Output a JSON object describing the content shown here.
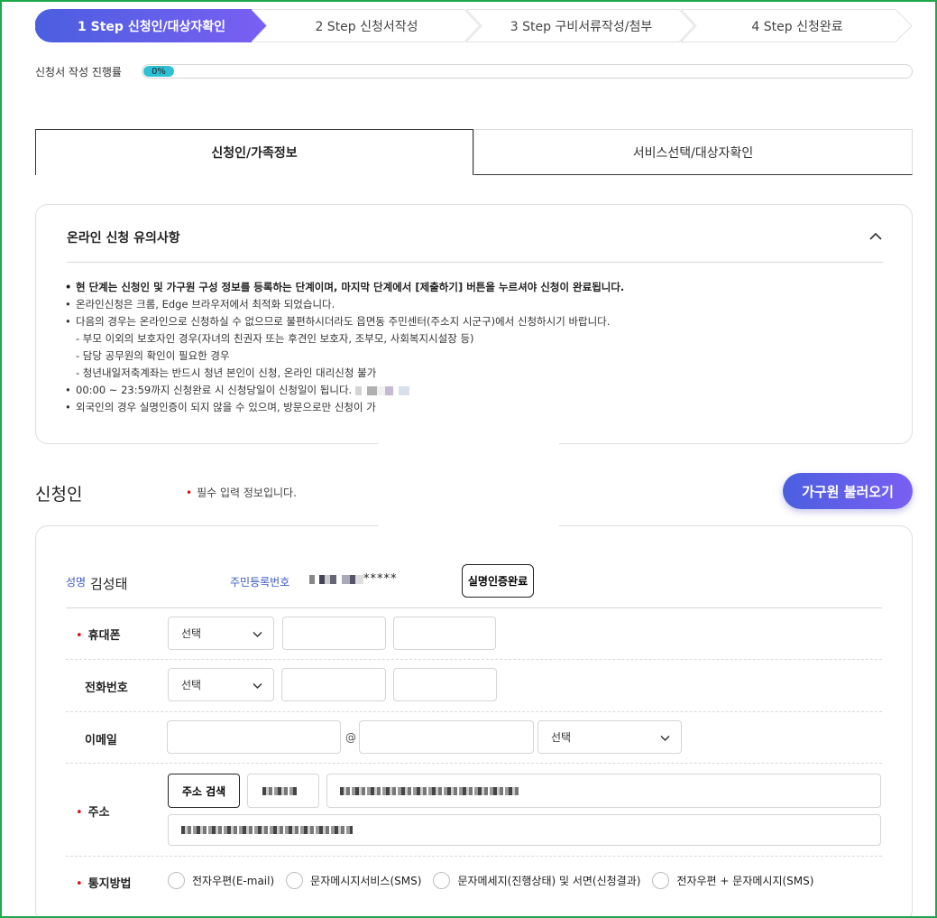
{
  "steps": [
    {
      "label": "1 Step 신청인/대상자확인",
      "active": true
    },
    {
      "label": "2 Step 신청서작성",
      "active": false
    },
    {
      "label": "3 Step 구비서류작성/첨부",
      "active": false
    },
    {
      "label": "4 Step 신청완료",
      "active": false
    }
  ],
  "progress": {
    "label": "신청서 작성 진행률",
    "value_text": "0%",
    "value": 0
  },
  "tabs": [
    {
      "label": "신청인/가족정보",
      "selected": true
    },
    {
      "label": "서비스선택/대상자확인",
      "selected": false
    }
  ],
  "notice": {
    "title": "온라인 신청 유의사항",
    "items": [
      "현 단계는 신청인 및 가구원 구성 정보를 등록하는 단계이며, 마지막 단계에서 [제출하기] 버튼을 누르셔야 신청이 완료됩니다.",
      "온라인신청은 크롬, Edge 브라우저에서 최적화 되었습니다.",
      "다음의 경우는 온라인으로 신청하실 수 없으므로 불편하시더라도 읍면동 주민센터(주소지 시군구)에서 신청하시기 바랍니다.",
      "- 부모 이외의 보호자인 경우(자녀의 친권자 또는 후견인 보호자, 조부모, 사회복지시설장 등)",
      "- 담당 공무원의 확인이 필요한 경우",
      "- 청년내일저축계좌는 반드시 청년 본인이 신청, 온라인 대리신청 불가",
      "00:00 ~ 23:59까지 신청완료 시 신청당일이 신청일이 됩니다.",
      "외국인의 경우 실명인증이 되지 않을 수 있으며, 방문으로만 신청이 가"
    ]
  },
  "applicant": {
    "section_title": "신청인",
    "required_note": "필수 입력 정보입니다.",
    "load_family_button": "가구원 불러오기",
    "name_label": "성명",
    "name_value": "김성태",
    "rrn_label": "주민등록번호",
    "rrn_masked": "*****",
    "verify_button": "실명인증완료",
    "mobile": {
      "label": "휴대폰",
      "select": "선택"
    },
    "phone": {
      "label": "전화번호",
      "select": "선택"
    },
    "email": {
      "label": "이메일",
      "at": "@",
      "select": "선택"
    },
    "address": {
      "label": "주소",
      "search_button": "주소 검색"
    },
    "notify": {
      "label": "통지방법",
      "options": [
        "전자우편(E-mail)",
        "문자메시지서비스(SMS)",
        "문자메세지(진행상태) 및 서면(신청결과)",
        "전자우편 + 문자메시지(SMS)"
      ]
    }
  },
  "colors": {
    "accent_start": "#4b5fe0",
    "accent_end": "#7a5ff2",
    "progress": "#2ec1d6",
    "required": "#dd1111",
    "label_blue": "#3b5bc4",
    "frame": "#1fa84a"
  }
}
